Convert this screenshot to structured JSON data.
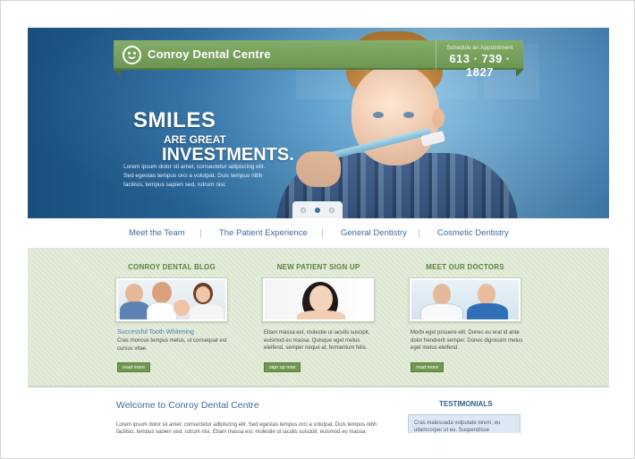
{
  "brand": {
    "name": "Conroy Dental Centre",
    "appointment_label": "Schedule an Appointment",
    "phone": "613 · 739 · 1827"
  },
  "hero": {
    "line1": "SMILES",
    "line2": "ARE GREAT",
    "line3": "INVESTMENTS.",
    "blurb": "Lorem ipsum dolor sit amet, consectetur adipiscing elit. Sed egestas tempus orci a volutpat. Duis tempus nibh facilisis, tempus sapien sed, rutrum nisi."
  },
  "nav": {
    "items": [
      {
        "label": "Meet the Team"
      },
      {
        "label": "The Patient Experience"
      },
      {
        "label": "General Dentistry"
      },
      {
        "label": "Cosmetic Dentistry"
      }
    ]
  },
  "columns": [
    {
      "title": "CONROY DENTAL BLOG",
      "subtitle": "Successful Tooth Whitening",
      "text": "Cras rhoncus tempus metus, ut consequat est cursus vitae.",
      "button": "read more"
    },
    {
      "title": "NEW PATIENT SIGN UP",
      "subtitle": "",
      "text": "Etiam massa est, molestie ut iaculis suscipit, euismod eu massa. Quisque eget metus eleifend, semper neque at, fermentum felis.",
      "button": "sign up now"
    },
    {
      "title": "MEET OUR DOCTORS",
      "subtitle": "",
      "text": "Morbi eget posuere elit. Donec eu erat id ante dolor hendrerit semper. Donec dignissim metus eget metus eleifend.",
      "button": "read more"
    }
  ],
  "lower": {
    "welcome_title": "Welcome to Conroy Dental Centre",
    "welcome_text": "Lorem ipsum dolor sit amet, consectetur adipiscing elit. Sed egestas tempus orci a volutpat. Duis tempus nibh facilisis, tempus sapien sed, rutrum nisi. Etiam massa est, molestie ut iaculis suscipit, euismod eu massa.",
    "testimonials_title": "TESTIMONIALS",
    "testimonial_text": "Cras malesuada vulputate lorem, eu ullamcorper ut eu. Suspendisse"
  },
  "colors": {
    "brand_green": "#6c9652",
    "link_blue": "#3d6aa0",
    "hero_blue": "#2f77b3",
    "content_bg": "#dfe9d3"
  }
}
